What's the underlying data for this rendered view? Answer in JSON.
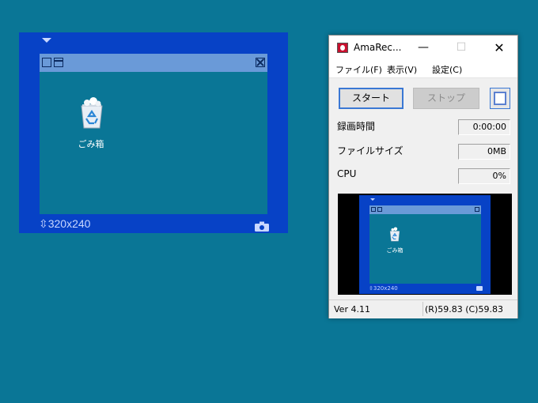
{
  "capture": {
    "desktop_icon_label": "ごみ箱",
    "size_readout": "320x240"
  },
  "amarec": {
    "title": "AmaRec...",
    "titlebar": {
      "minimize": "—",
      "maximize": "☐",
      "close": "✕"
    },
    "menu": [
      "ファイル(F)",
      "表示(V)",
      "設定(C)"
    ],
    "buttons": {
      "start": "スタート",
      "stop": "ストップ"
    },
    "stats": [
      {
        "label": "録画時間",
        "value": "0:00:00"
      },
      {
        "label": "ファイルサイズ",
        "value": "0MB"
      },
      {
        "label": "CPU",
        "value": "0%"
      }
    ],
    "preview": {
      "icon_label": "ごみ箱",
      "size_readout": "320x240"
    },
    "status": {
      "version": "Ver 4.11",
      "rate": "(R)59.83 (C)59.83"
    }
  },
  "colors": {
    "desktop": "#0a7696",
    "capture_frame": "#0742c6",
    "capture_titlebar": "#6a9ad8",
    "record_icon": "#c8102e"
  }
}
